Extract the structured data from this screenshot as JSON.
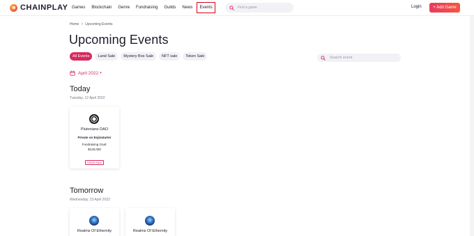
{
  "header": {
    "brand": "CHAINPLAY",
    "nav": [
      "Games",
      "Blockchain",
      "Genre",
      "Fundraising",
      "Guilds",
      "News",
      "Events"
    ],
    "active_nav": "Events",
    "search_placeholder": "Find a game",
    "login_label": "Login",
    "add_game_label": "+ Add Game"
  },
  "breadcrumb": [
    "Home",
    "Upcoming Events"
  ],
  "breadcrumb_separator": ">",
  "page_title": "Upcoming Events",
  "filters": [
    "All Events",
    "Land Sale",
    "Mystery Box Sale",
    "NFT sale",
    "Token Sale"
  ],
  "active_filter": "All Events",
  "event_search_placeholder": "Search event",
  "month_selector": "April 2022",
  "sections": [
    {
      "title": "Today",
      "date": "Tuesday, 12 April 2022",
      "cards": [
        {
          "name": "Plutonians DAO",
          "platform": "Private on Enjinstarter",
          "goal_label": "Fundraising Goal:",
          "goal_value": "$125,000",
          "tag": "TOKEN SALE",
          "icon": "plutonians-logo-icon"
        }
      ]
    },
    {
      "title": "Tomorrow",
      "date": "Wednesday, 13 April 2022",
      "cards": [
        {
          "name": "Realms Of Ethernity",
          "icon": "realms-logo-icon"
        },
        {
          "name": "Realms Of Ethernity",
          "icon": "realms-logo-icon"
        }
      ]
    }
  ],
  "colors": {
    "accent": "#d62a5f",
    "highlight_box": "#d0021b",
    "chip_bg": "#f1f1f6"
  }
}
